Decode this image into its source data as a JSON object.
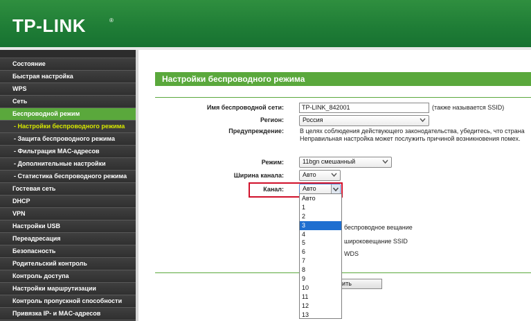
{
  "brand": {
    "logo": "TP-LINK",
    "mark": "®"
  },
  "sidebar": {
    "items": [
      {
        "label": "Состояние"
      },
      {
        "label": "Быстрая настройка"
      },
      {
        "label": "WPS"
      },
      {
        "label": "Сеть"
      },
      {
        "label": "Беспроводной режим",
        "active": true
      },
      {
        "label": "- Настройки беспроводного режима",
        "sub": true,
        "active": true
      },
      {
        "label": "- Защита беспроводного режима",
        "sub": true
      },
      {
        "label": "- Фильтрация MAC-адресов",
        "sub": true
      },
      {
        "label": "- Дополнительные настройки",
        "sub": true
      },
      {
        "label": "- Статистика беспроводного режима",
        "sub": true
      },
      {
        "label": "Гостевая сеть"
      },
      {
        "label": "DHCP"
      },
      {
        "label": "VPN"
      },
      {
        "label": "Настройки USB"
      },
      {
        "label": "Переадресация"
      },
      {
        "label": "Безопасность"
      },
      {
        "label": "Родительский контроль"
      },
      {
        "label": "Контроль доступа"
      },
      {
        "label": "Настройки маршрутизации"
      },
      {
        "label": "Контроль пропускной способности"
      },
      {
        "label": "Привязка IP- и MAC-адресов"
      }
    ]
  },
  "main": {
    "title": "Настройки беспроводного режима",
    "ssid": {
      "label": "Имя беспроводной сети:",
      "value": "TP-LINK_842001",
      "note": "(также называется SSID)"
    },
    "region": {
      "label": "Регион:",
      "value": "Россия"
    },
    "warning": {
      "label": "Предупреждение:",
      "line1": "В целях соблюдения действующего законодательства, убедитесь, что страна",
      "line2": "Неправильная настройка может послужить причиной возникновения помех."
    },
    "mode": {
      "label": "Режим:",
      "value": "11bgn смешанный"
    },
    "width": {
      "label": "Ширина канала:",
      "value": "Авто"
    },
    "channel": {
      "label": "Канал:",
      "value": "Авто",
      "options": [
        "Авто",
        "1",
        "2",
        "3",
        "4",
        "5",
        "6",
        "7",
        "8",
        "9",
        "10",
        "11",
        "12",
        "13"
      ],
      "highlighted": "3"
    },
    "checkboxes": {
      "broadcast": "беспроводное вещание",
      "ssid_broadcast": "широковещание SSID",
      "wds": "WDS"
    },
    "save_label_partial": "анить"
  },
  "colors": {
    "accent": "#5aa83c",
    "header": "#1f7d36",
    "highlight": "#d0102a",
    "selection": "#1f6fd0"
  }
}
